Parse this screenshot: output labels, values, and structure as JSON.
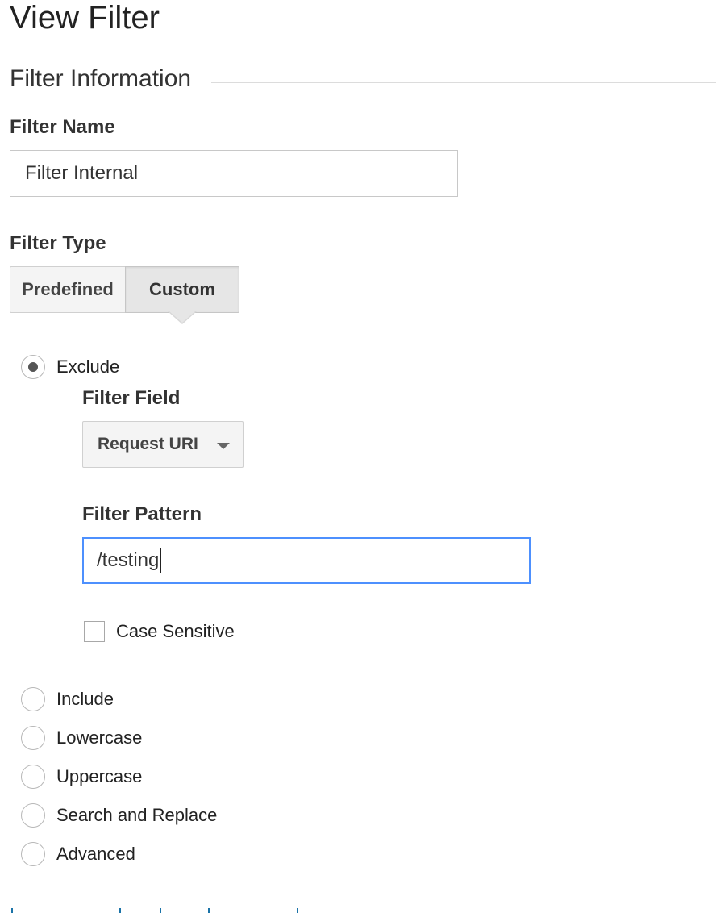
{
  "page": {
    "title": "View Filter"
  },
  "filter_information": {
    "section_title": "Filter Information",
    "filter_name": {
      "label": "Filter Name",
      "value": "Filter Internal"
    },
    "filter_type": {
      "label": "Filter Type",
      "tabs": [
        {
          "label": "Predefined",
          "selected": false
        },
        {
          "label": "Custom",
          "selected": true
        }
      ]
    },
    "custom_options": [
      {
        "label": "Exclude",
        "selected": true
      },
      {
        "label": "Include",
        "selected": false
      },
      {
        "label": "Lowercase",
        "selected": false
      },
      {
        "label": "Uppercase",
        "selected": false
      },
      {
        "label": "Search and Replace",
        "selected": false
      },
      {
        "label": "Advanced",
        "selected": false
      }
    ],
    "exclude": {
      "filter_field": {
        "label": "Filter Field",
        "selected_value": "Request URI"
      },
      "filter_pattern": {
        "label": "Filter Pattern",
        "value": "/testing"
      },
      "case_sensitive": {
        "label": "Case Sensitive",
        "checked": false
      }
    }
  },
  "colors": {
    "focus_border": "#4d90fe",
    "selected_radio_dot": "#555555",
    "link": "#1a73a8"
  }
}
